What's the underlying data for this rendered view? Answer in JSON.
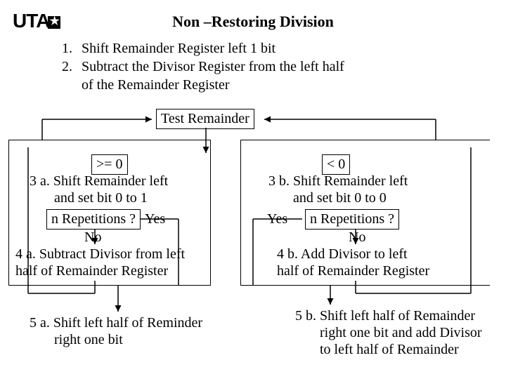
{
  "logo": "UTA",
  "title": "Non –Restoring Division",
  "steps": {
    "s1": {
      "num": "1.",
      "text": "Shift  Remainder Register left 1 bit"
    },
    "s2": {
      "num": "2.",
      "text": "Subtract the Divisor Register from the left half"
    },
    "s2b": "of the Remainder Register"
  },
  "test_box": "Test Remainder",
  "left": {
    "cond": ">= 0",
    "step3": "3 a. Shift Remainder left\n       and set bit 0 to 1",
    "nrep": "n Repetitions ?",
    "yes": "Yes",
    "no": "No",
    "step4": "4 a. Subtract Divisor from left\nhalf of Remainder Register",
    "step5": "5 a. Shift left half of Reminder\n       right one bit"
  },
  "right": {
    "cond": "< 0",
    "step3": "3 b. Shift Remainder left\n       and set bit 0 to 0",
    "nrep": "n Repetitions ?",
    "yes": "Yes",
    "no": "No",
    "step4": "4 b. Add Divisor to left\nhalf of Remainder Register",
    "step5": "5 b. Shift left half of Remainder\n       right one bit and add Divisor\n       to left half of Remainder"
  }
}
